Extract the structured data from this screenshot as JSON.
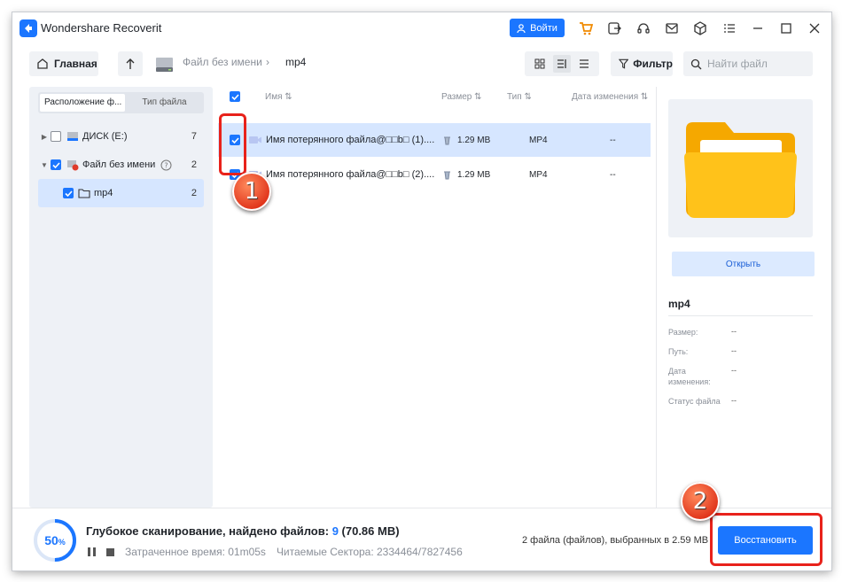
{
  "app": {
    "title": "Wondershare Recoverit",
    "login_label": "Войти"
  },
  "toolbar": {
    "home_label": "Главная",
    "breadcrumb_drive": "Файл без имени",
    "breadcrumb_sep": "›",
    "breadcrumb_folder": "mp4",
    "filter_label": "Фильтр",
    "search_placeholder": "Найти файл"
  },
  "sidebar": {
    "tabs": [
      "Расположение ф...",
      "Тип файла"
    ],
    "tree": [
      {
        "label": "ДИСК (E:)",
        "count": "7",
        "checked": false
      },
      {
        "label": "Файл без имени",
        "count": "2",
        "checked": true
      },
      {
        "label": "mp4",
        "count": "2",
        "checked": true
      }
    ]
  },
  "filelist": {
    "columns": {
      "name": "Имя ⇅",
      "size": "Размер ⇅",
      "type": "Тип ⇅",
      "date": "Дата изменения ⇅"
    },
    "rows": [
      {
        "name": "Имя потерянного файла@□□b□ (1)....",
        "size": "1.29 MB",
        "type": "MP4",
        "date": "--"
      },
      {
        "name": "Имя потерянного файла@□□b□ (2)....",
        "size": "1.29 MB",
        "type": "MP4",
        "date": "--"
      }
    ]
  },
  "preview": {
    "open_label": "Открыть",
    "title": "mp4",
    "size_label": "Размер:",
    "size_value": "--",
    "path_label": "Путь:",
    "path_value": "--",
    "date_label": "Дата изменения:",
    "date_value": "--",
    "status_label": "Статус файла",
    "status_value": "--"
  },
  "status": {
    "percent": "50",
    "percent_sign": "%",
    "scan_title_prefix": "Глубокое сканирование, найдено файлов: ",
    "found_count": "9",
    "found_size": " (70.86 MB)",
    "elapsed": "Затраченное время: 01m05s",
    "sectors": "Читаемые Сектора: 2334464/7827456",
    "selection": "2 файла (файлов), выбранных в 2.59 MB",
    "recover_label": "Восстановить"
  },
  "annotations": {
    "badge1": "1",
    "badge2": "2"
  },
  "colors": {
    "accent": "#1b76ff",
    "highlight": "#d6e6ff",
    "annotation": "#e8221b",
    "folder": "#ffc21a"
  }
}
